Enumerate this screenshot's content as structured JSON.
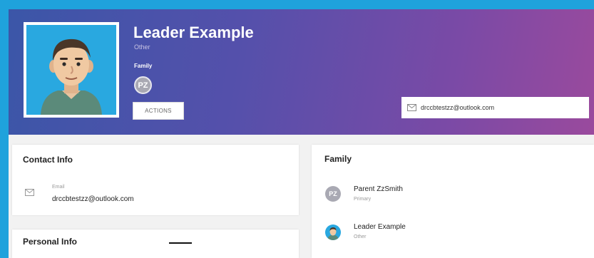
{
  "profile": {
    "name": "Leader Example",
    "role": "Other",
    "family_label": "Family",
    "family_chip": "PZ",
    "actions_label": "ACTIONS",
    "email": "drccbtestzz@outlook.com"
  },
  "contact": {
    "title": "Contact Info",
    "email_label": "Email",
    "email_value": "drccbtestzz@outlook.com"
  },
  "personal": {
    "title": "Personal Info"
  },
  "family": {
    "title": "Family",
    "members": [
      {
        "initials": "PZ",
        "name": "Parent ZzSmith",
        "relation": "Primary"
      },
      {
        "initials": "",
        "name": "Leader Example",
        "relation": "Other"
      }
    ]
  },
  "icons": {
    "email": "mail-icon",
    "avatar": "person-avatar"
  },
  "colors": {
    "frame": "#1fa2dc",
    "banner_start": "#3b56a8",
    "banner_end": "#9a4a9d",
    "avatar_bg": "#29a8e0"
  }
}
